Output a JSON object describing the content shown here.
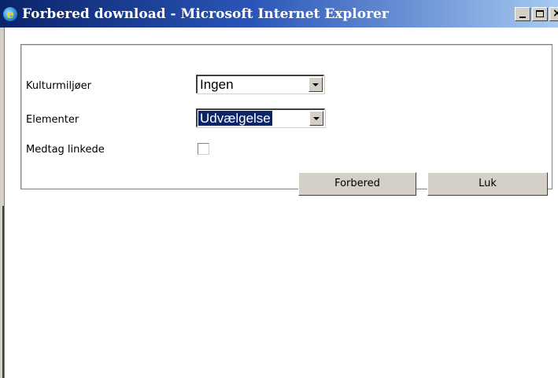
{
  "window": {
    "title": "Forbered download - Microsoft Internet Explorer",
    "icon": "ie-icon",
    "controls": {
      "minimize_glyph": "_",
      "close_glyph": "×"
    }
  },
  "form": {
    "fields": [
      {
        "label": "Kulturmiljøer",
        "value": "Ingen",
        "type": "select"
      },
      {
        "label": "Elementer",
        "value": "Udvælgelse",
        "type": "select",
        "highlighted": true
      },
      {
        "label": "Medtag linkede",
        "type": "checkbox",
        "checked": false
      }
    ],
    "buttons": {
      "prepare": "Forbered",
      "close": "Luk"
    }
  },
  "colors": {
    "titlebar_start": "#0a246a",
    "titlebar_end": "#a6caf0",
    "face": "#d4d0c8",
    "highlight": "#0a246a"
  }
}
